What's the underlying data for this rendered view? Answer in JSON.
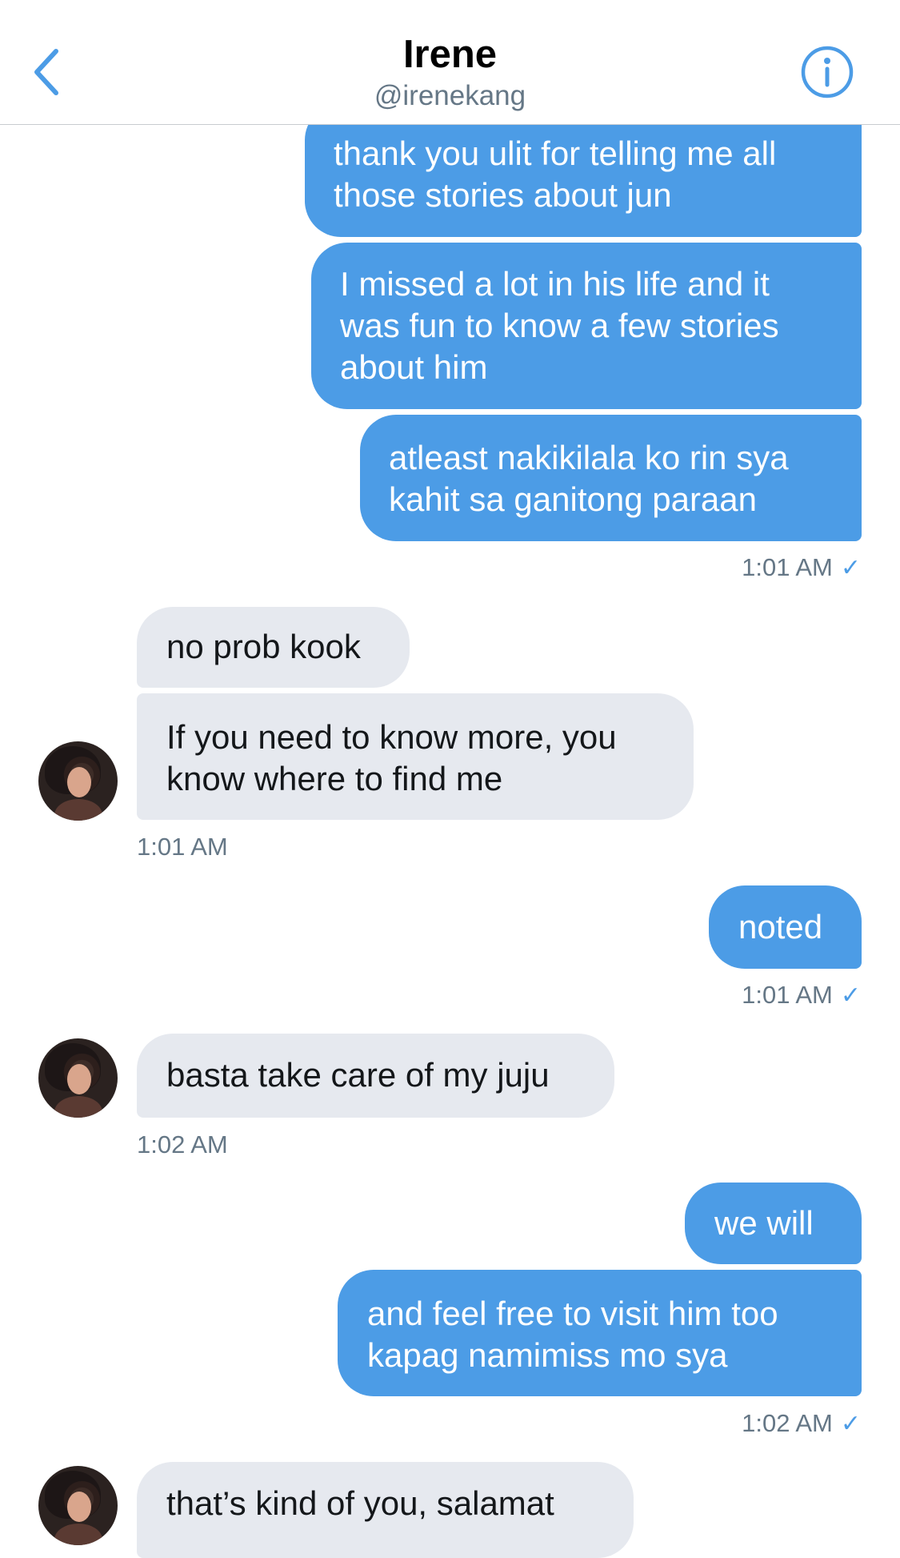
{
  "header": {
    "title": "Irene",
    "handle": "@irenekang",
    "back_icon": "chevron-left-icon",
    "info_icon": "info-icon"
  },
  "colors": {
    "accent": "#4c9ce6",
    "outgoing_bubble": "#4c9ce6",
    "incoming_bubble": "#e6e9ef",
    "timestamp": "#657786"
  },
  "messages": [
    {
      "direction": "out",
      "text": "thank you ulit for telling me all\nthose stories about jun"
    },
    {
      "direction": "out",
      "text": "I missed a lot in his life and it\nwas fun to know a few stories\nabout him"
    },
    {
      "direction": "out",
      "text": "atleast nakikilala ko rin sya\nkahit sa ganitong paraan"
    },
    {
      "direction": "out",
      "time": "1:01 AM",
      "check": "✓"
    },
    {
      "direction": "in",
      "text": "no prob kook"
    },
    {
      "direction": "in",
      "text": "If you need to know more, you\nknow where to find me"
    },
    {
      "direction": "in",
      "time": "1:01 AM"
    },
    {
      "direction": "out",
      "text": "noted"
    },
    {
      "direction": "out",
      "time": "1:01 AM",
      "check": "✓"
    },
    {
      "direction": "in",
      "text": "basta take care of my juju"
    },
    {
      "direction": "in",
      "time": "1:02 AM"
    },
    {
      "direction": "out",
      "text": "we will"
    },
    {
      "direction": "out",
      "text": "and feel free to visit him too\nkapag namimiss mo sya"
    },
    {
      "direction": "out",
      "time": "1:02 AM",
      "check": "✓"
    },
    {
      "direction": "in",
      "text": "that’s kind of you, salamat"
    }
  ]
}
